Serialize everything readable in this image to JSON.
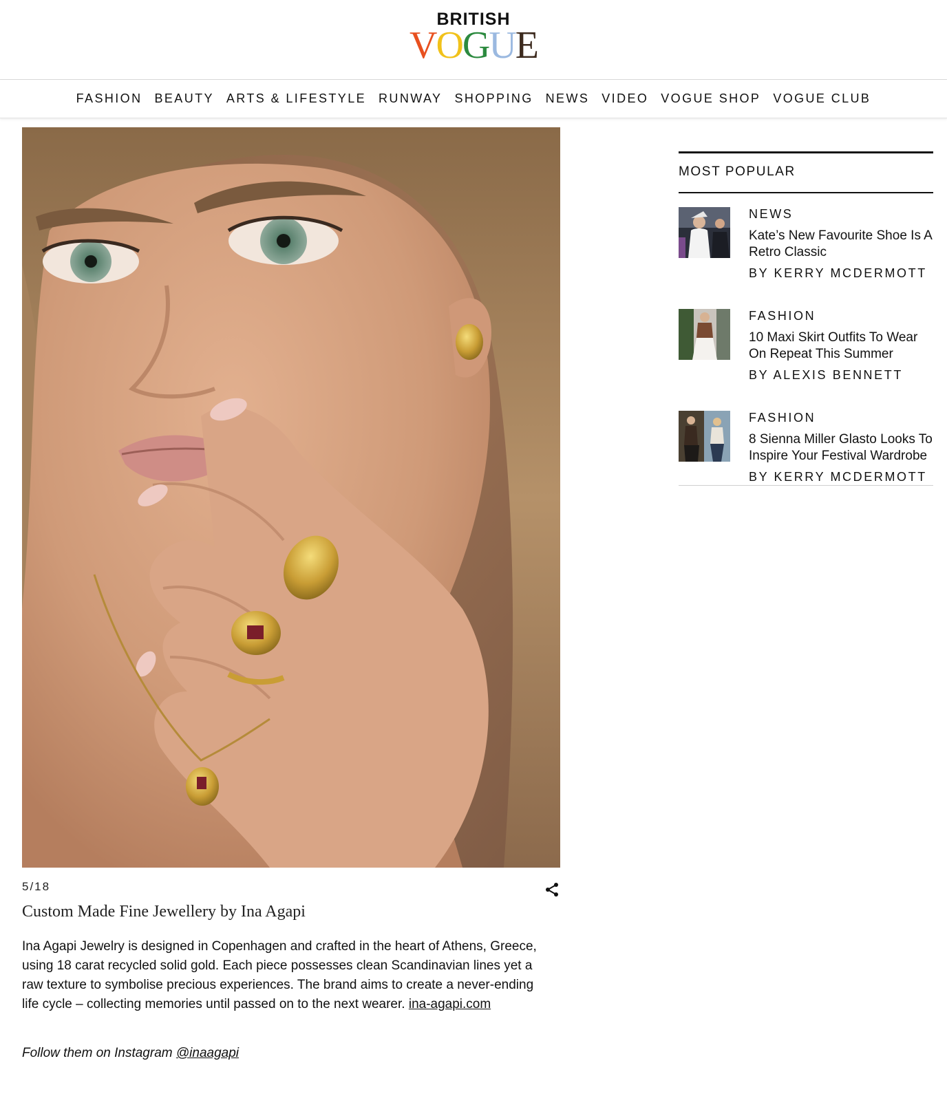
{
  "brand": {
    "top": "BRITISH",
    "letters": [
      {
        "char": "V",
        "color": "#e8501f"
      },
      {
        "char": "O",
        "color": "#f1c21b"
      },
      {
        "char": "G",
        "color": "#2c8a3f"
      },
      {
        "char": "U",
        "color": "#9bb9e0"
      },
      {
        "char": "E",
        "color": "#3d2b1f"
      }
    ]
  },
  "nav": {
    "items": [
      "FASHION",
      "BEAUTY",
      "ARTS & LIFESTYLE",
      "RUNWAY",
      "SHOPPING",
      "NEWS",
      "VIDEO",
      "VOGUE SHOP",
      "VOGUE CLUB"
    ]
  },
  "gallery": {
    "counter": "5/18",
    "title": "Custom Made Fine Jewellery by Ina Agapi",
    "body": "Ina Agapi Jewelry is designed in Copenhagen and crafted in the heart of Athens, Greece, using 18 carat recycled solid gold. Each piece possesses clean Scandinavian lines yet a raw texture to symbolise precious experiences. The brand aims to create a never-ending life cycle – collecting memories until passed on to the next wearer. ",
    "link": "ina-agapi.com",
    "follow_prefix": "Follow them on Instagram ",
    "follow_handle": "@inaagapi"
  },
  "sidebar": {
    "heading": "MOST POPULAR",
    "items": [
      {
        "category": "NEWS",
        "title": "Kate’s New Favourite Shoe Is A Retro Classic",
        "author": "BY KERRY MCDERMOTT"
      },
      {
        "category": "FASHION",
        "title": "10 Maxi Skirt Outfits To Wear On Repeat This Summer",
        "author": "BY ALEXIS BENNETT"
      },
      {
        "category": "FASHION",
        "title": "8 Sienna Miller Glasto Looks To Inspire Your Festival Wardrobe",
        "author": "BY KERRY MCDERMOTT"
      }
    ]
  },
  "icons": {
    "share": "share-icon"
  }
}
